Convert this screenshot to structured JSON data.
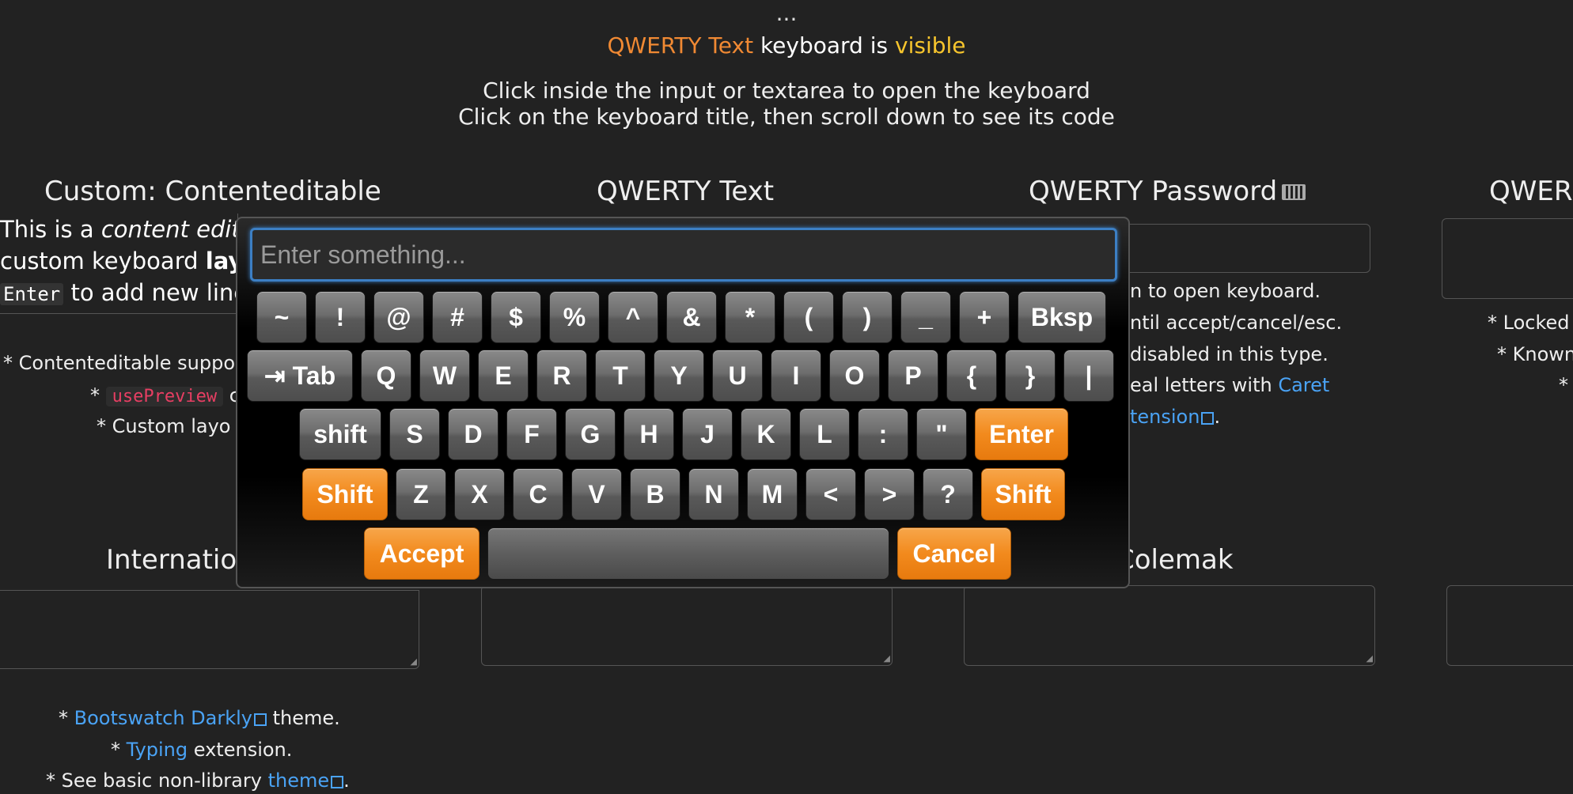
{
  "header": {
    "ellipsis": "...",
    "status_keyboard": "QWERTY Text",
    "status_mid": " keyboard is ",
    "status_state": "visible",
    "instruction_1": "Click inside the input or textarea to open the keyboard",
    "instruction_2": "Click on the keyboard title, then scroll down to see its code"
  },
  "columns": {
    "custom_contenteditable": "Custom: Contenteditable",
    "qwerty_text": "QWERTY Text",
    "qwerty_password": "QWERTY Password",
    "qwerty_partial": "QWER",
    "international_partial": "Internation",
    "colemak_partial": "Colemak"
  },
  "contenteditable": {
    "line1_a": "This is a ",
    "line1_em": "content edita",
    "line2_a": "custom keyboard ",
    "line2_b": "layo",
    "line3_code": "Enter",
    "line3_rest": " to add new line"
  },
  "notes_left": {
    "n1": "* Contenteditable suppo",
    "n2_prefix": "* ",
    "n2_code": "usePreview",
    "n2_suffix": " c",
    "n3": "* Custom layo"
  },
  "notes_password": {
    "n1": "n to open keyboard.",
    "n2": "ntil accept/cancel/esc.",
    "n3": "disabled in this type.",
    "n4_a": "eal letters with ",
    "n4_link": "Caret",
    "n5_link": "tension",
    "n5_end": "."
  },
  "notes_right": {
    "n1": "* Locked",
    "n2": "* Known",
    "n3": "*"
  },
  "notes_bottom": {
    "b1_prefix": "* ",
    "b1_link": "Bootswatch Darkly",
    "b1_suffix": " theme.",
    "b2_prefix": "* ",
    "b2_link": "Typing",
    "b2_suffix": " extension.",
    "b3_prefix": "* See basic non-library ",
    "b3_link": "theme",
    "b3_suffix": "."
  },
  "keyboard": {
    "placeholder": "Enter something...",
    "rows": [
      [
        "~",
        "!",
        "@",
        "#",
        "$",
        "%",
        "^",
        "&",
        "*",
        "(",
        ")",
        "_",
        "+",
        "Bksp"
      ],
      [
        "⇥ Tab",
        "Q",
        "W",
        "E",
        "R",
        "T",
        "Y",
        "U",
        "I",
        "O",
        "P",
        "{",
        "}",
        "|"
      ],
      [
        "shift",
        "S",
        "D",
        "F",
        "G",
        "H",
        "J",
        "K",
        "L",
        ":",
        "\"",
        "Enter"
      ],
      [
        "Shift",
        "Z",
        "X",
        "C",
        "V",
        "B",
        "N",
        "M",
        "<",
        ">",
        "?",
        "Shift"
      ],
      [
        "Accept",
        " ",
        "Cancel"
      ]
    ]
  },
  "colors": {
    "background": "#222222",
    "accent_orange": "#f08933",
    "accent_yellow": "#f7c52d",
    "link": "#4aa3f5"
  }
}
